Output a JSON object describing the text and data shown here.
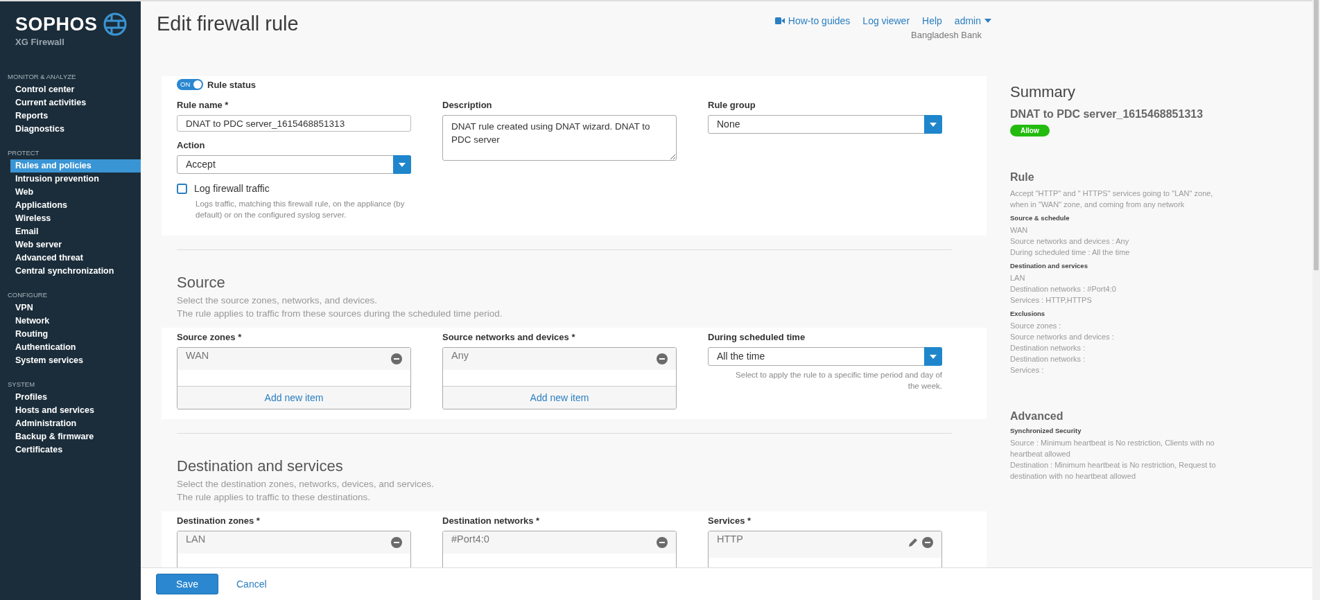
{
  "sidebar": {
    "brand": "SOPHOS",
    "product": "XG Firewall",
    "sections": [
      {
        "title": "MONITOR & ANALYZE",
        "items": [
          {
            "label": "Control center",
            "selected": false
          },
          {
            "label": "Current activities",
            "selected": false
          },
          {
            "label": "Reports",
            "selected": false
          },
          {
            "label": "Diagnostics",
            "selected": false
          }
        ]
      },
      {
        "title": "PROTECT",
        "items": [
          {
            "label": "Rules and policies",
            "selected": true
          },
          {
            "label": "Intrusion prevention",
            "selected": false
          },
          {
            "label": "Web",
            "selected": false
          },
          {
            "label": "Applications",
            "selected": false
          },
          {
            "label": "Wireless",
            "selected": false
          },
          {
            "label": "Email",
            "selected": false
          },
          {
            "label": "Web server",
            "selected": false
          },
          {
            "label": "Advanced threat",
            "selected": false
          },
          {
            "label": "Central synchronization",
            "selected": false
          }
        ]
      },
      {
        "title": "CONFIGURE",
        "items": [
          {
            "label": "VPN",
            "selected": false
          },
          {
            "label": "Network",
            "selected": false
          },
          {
            "label": "Routing",
            "selected": false
          },
          {
            "label": "Authentication",
            "selected": false
          },
          {
            "label": "System services",
            "selected": false
          }
        ]
      },
      {
        "title": "SYSTEM",
        "items": [
          {
            "label": "Profiles",
            "selected": false
          },
          {
            "label": "Hosts and services",
            "selected": false
          },
          {
            "label": "Administration",
            "selected": false
          },
          {
            "label": "Backup & firmware",
            "selected": false
          },
          {
            "label": "Certificates",
            "selected": false
          }
        ]
      }
    ]
  },
  "header": {
    "title": "Edit firewall rule",
    "links": [
      {
        "label": "How-to guides",
        "kind": "video"
      },
      {
        "label": "Log viewer",
        "kind": "plain"
      },
      {
        "label": "Help",
        "kind": "plain"
      },
      {
        "label": "admin",
        "kind": "menu"
      }
    ],
    "organization": "Bangladesh Bank"
  },
  "general": {
    "status": {
      "toggle_text": "ON",
      "on": true,
      "label": "Rule status"
    },
    "rule_name": {
      "label": "Rule name *",
      "value": "DNAT to PDC server_1615468851313"
    },
    "action": {
      "label": "Action",
      "value": "Accept"
    },
    "log_traffic": {
      "label": "Log firewall traffic",
      "checked": false,
      "help": "Logs traffic, matching this firewall rule, on the appliance (by default) or on the configured syslog server."
    },
    "description": {
      "label": "Description",
      "value": "DNAT rule created using DNAT wizard. DNAT to PDC server"
    },
    "rule_group": {
      "label": "Rule group",
      "value": "None"
    }
  },
  "sections": [
    {
      "title": "Source",
      "subtitle_lines": [
        "Select the source zones, networks, and devices.",
        "The rule applies to traffic from these sources during the scheduled time period."
      ],
      "fields": [
        {
          "kind": "list",
          "label": "Source zones *",
          "items": [
            {
              "text": "WAN",
              "editable": false
            }
          ],
          "add_label": "Add new item"
        },
        {
          "kind": "list",
          "label": "Source networks and devices *",
          "items": [
            {
              "text": "Any",
              "editable": false
            }
          ],
          "add_label": "Add new item"
        },
        {
          "kind": "select",
          "label": "During scheduled time",
          "value": "All the time",
          "help": "Select to apply the rule to a specific time period and day of the week."
        }
      ]
    },
    {
      "title": "Destination and services",
      "subtitle_lines": [
        "Select the destination zones, networks, devices, and services.",
        "The rule applies to traffic to these destinations."
      ],
      "fields": [
        {
          "kind": "list",
          "label": "Destination zones *",
          "items": [
            {
              "text": "LAN",
              "editable": false
            }
          ]
        },
        {
          "kind": "list",
          "label": "Destination networks *",
          "items": [
            {
              "text": "#Port4:0",
              "editable": false
            }
          ]
        },
        {
          "kind": "list",
          "label": "Services *",
          "items": [
            {
              "text": "HTTP",
              "editable": true
            }
          ]
        }
      ]
    }
  ],
  "footer": {
    "buttons": [
      {
        "label": "Save",
        "kind": "primary"
      },
      {
        "label": "Cancel",
        "kind": "link"
      }
    ]
  },
  "summary": {
    "title": "Summary",
    "rule_name": "DNAT to PDC server_1615468851313",
    "badge": "Allow",
    "groups": [
      {
        "title": "Rule",
        "blocks": [
          {
            "paragraphs": [
              "Accept \"HTTP\" and \" HTTPS\" services going to \"LAN\" zone, when in \"WAN\" zone, and coming from any network"
            ]
          },
          {
            "heading": "Source & schedule",
            "paragraphs": [
              "WAN",
              "Source networks and devices : Any",
              "During scheduled time : All the time"
            ]
          },
          {
            "heading": "Destination and services",
            "paragraphs": [
              "LAN",
              "Destination networks : #Port4:0",
              "Services : HTTP,HTTPS"
            ]
          },
          {
            "heading": "Exclusions",
            "paragraphs": [
              "Source zones :",
              "Source networks and devices :",
              "Destination networks :",
              "Destination networks :",
              "Services :"
            ]
          }
        ]
      },
      {
        "title": "Advanced",
        "blocks": [
          {
            "heading": "Synchronized Security",
            "paragraphs": [
              "Source : Minimum heartbeat is No restriction, Clients with no heartbeat allowed",
              "Destination : Minimum heartbeat is No restriction, Request to destination with no heartbeat allowed"
            ]
          }
        ]
      }
    ]
  }
}
